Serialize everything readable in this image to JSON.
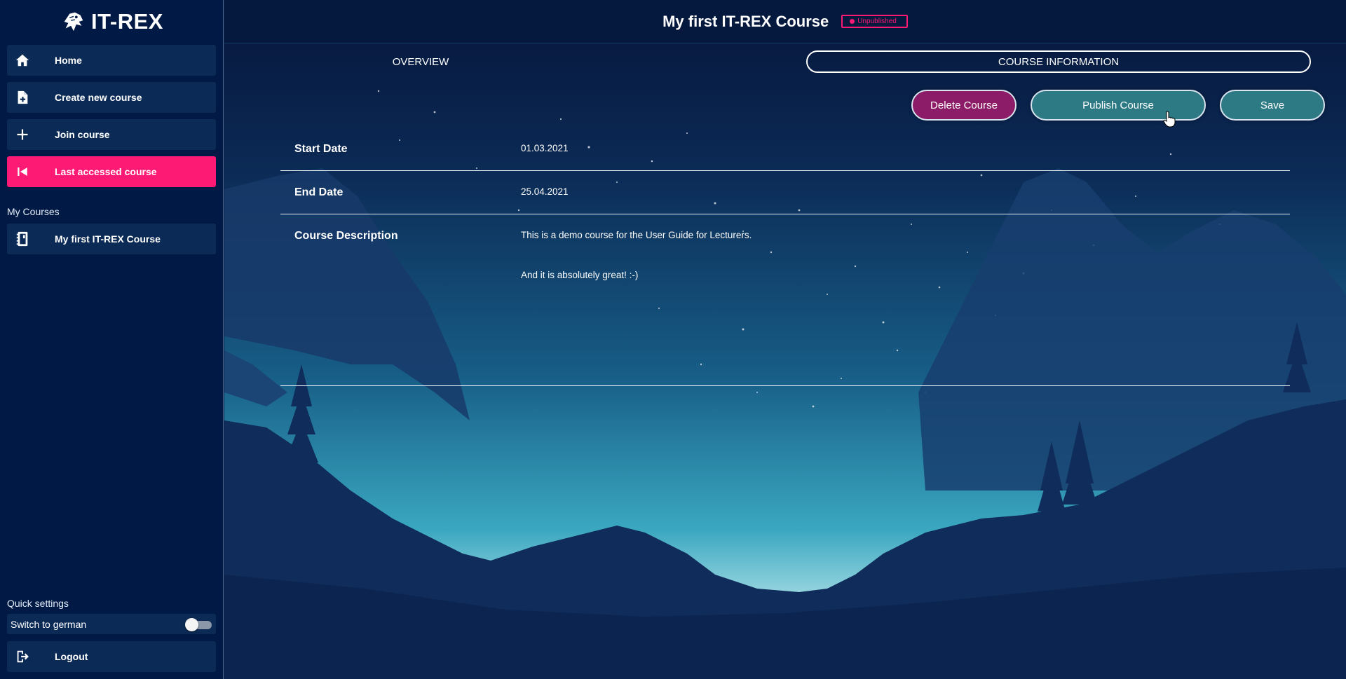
{
  "app": {
    "logo_text": "IT-REX"
  },
  "sidebar": {
    "nav": [
      {
        "label": "Home",
        "icon": "home-icon"
      },
      {
        "label": "Create new course",
        "icon": "file-plus-icon"
      },
      {
        "label": "Join course",
        "icon": "plus-icon"
      },
      {
        "label": "Last accessed course",
        "icon": "skip-back-icon",
        "active": true
      }
    ],
    "my_courses_label": "My Courses",
    "courses": [
      {
        "label": "My first IT-REX Course",
        "icon": "notebook-icon"
      }
    ],
    "quick_settings_label": "Quick settings",
    "switch_label": "Switch to german",
    "switch_on": false,
    "logout_label": "Logout"
  },
  "header": {
    "course_title": "My first IT-REX Course",
    "status_badge": "Unpublished"
  },
  "tabs": [
    {
      "label": "OVERVIEW",
      "active": false
    },
    {
      "label": "COURSE INFORMATION",
      "active": true
    }
  ],
  "actions": {
    "delete_label": "Delete Course",
    "publish_label": "Publish Course",
    "save_label": "Save"
  },
  "fields": {
    "start_date_label": "Start Date",
    "start_date_value": "01.03.2021",
    "end_date_label": "End Date",
    "end_date_value": "25.04.2021",
    "description_label": "Course Description",
    "description_lines": [
      "This is a demo course for the User Guide for Lecturers.",
      "And it is absolutely great! :-)"
    ]
  },
  "colors": {
    "accent_pink": "#fd1a74",
    "sidebar_bg": "#001a45",
    "nav_item_bg": "#0b2b56",
    "delete_bg": "#8c1c67",
    "teal_button": "#2d7a85"
  }
}
